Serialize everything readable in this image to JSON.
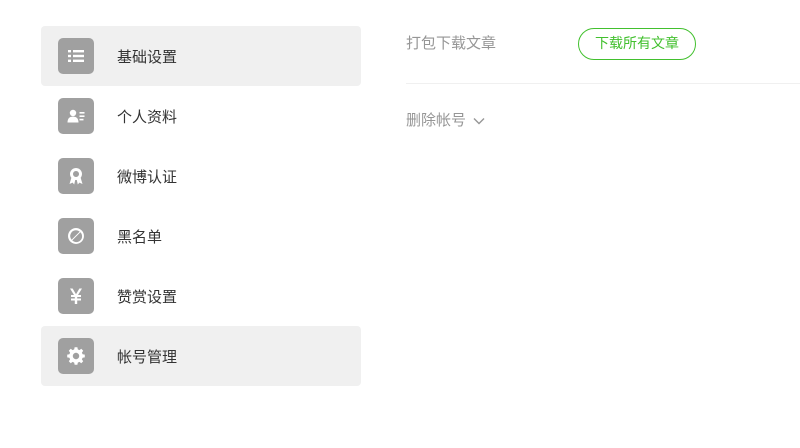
{
  "sidebar": {
    "items": [
      {
        "label": "基础设置",
        "icon": "list-icon",
        "active": true
      },
      {
        "label": "个人资料",
        "icon": "profile-card-icon",
        "active": false
      },
      {
        "label": "微博认证",
        "icon": "badge-icon",
        "active": false
      },
      {
        "label": "黑名单",
        "icon": "block-icon",
        "active": false
      },
      {
        "label": "赞赏设置",
        "icon": "yen-icon",
        "active": false
      },
      {
        "label": "帐号管理",
        "icon": "gear-icon",
        "active": true
      }
    ]
  },
  "main": {
    "download": {
      "label": "打包下载文章",
      "button": "下载所有文章"
    },
    "delete": {
      "label": "删除帐号"
    }
  },
  "colors": {
    "accent_green": "#42c02e",
    "icon_bg": "#a0a0a0",
    "active_bg": "#f0f0f0",
    "muted_text": "#969696"
  }
}
